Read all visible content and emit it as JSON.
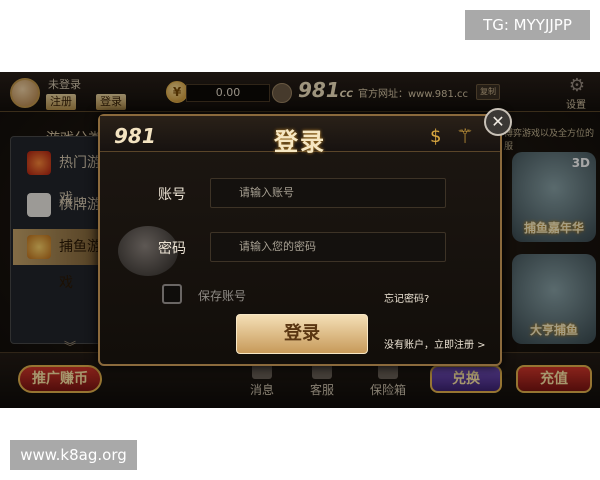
{
  "watermarks": {
    "top": "TG: MYYJJPP",
    "bottom": "www.k8ag.org"
  },
  "header": {
    "user_status": "未登录",
    "register_label": "注册",
    "login_label": "登录",
    "balance": "0.00",
    "logo": "981",
    "logo_sub": "CC",
    "site_label": "官方网址：www.981.cc",
    "copy_label": "复制",
    "settings_label": "设置"
  },
  "sidebar": {
    "title": "游戏分类",
    "items": [
      {
        "label": "热门游戏",
        "icon": "hot-icon"
      },
      {
        "label": "棋牌游戏",
        "icon": "cards-icon"
      },
      {
        "label": "捕鱼游戏",
        "icon": "fish-icon"
      }
    ]
  },
  "right_panel": {
    "banner": "博弈游戏以及全方位的服",
    "tiles": [
      {
        "caption": "捕鱼嘉年华",
        "badge": "3D"
      },
      {
        "caption": "大亨捕鱼",
        "badge": ""
      }
    ]
  },
  "bottom_nav": {
    "promo": "推广赚币",
    "items": [
      {
        "label": "消息",
        "icon": "message-icon"
      },
      {
        "label": "客服",
        "icon": "support-icon"
      },
      {
        "label": "保险箱",
        "icon": "safe-icon"
      }
    ],
    "exchange": "兑换",
    "recharge": "充值"
  },
  "dialog": {
    "logo": "981",
    "title": "登录",
    "account_label": "账号",
    "account_placeholder": "请输入账号",
    "password_label": "密码",
    "password_placeholder": "请输入您的密码",
    "save_account": "保存账号",
    "forgot": "忘记密码?",
    "login_button": "登录",
    "register_link": "没有账户，立即注册 >"
  },
  "colors": {
    "accent_gold": "#c79a5a",
    "background": "#17120d",
    "dialog_border": "#8b6a3c"
  }
}
